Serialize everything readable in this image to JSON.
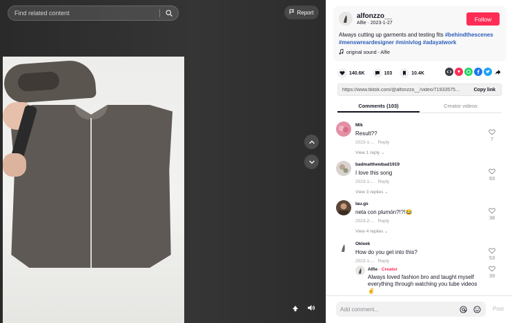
{
  "search": {
    "placeholder": "Find related content",
    "icon": "search-icon"
  },
  "video": {
    "report_label": "Report",
    "nav_up_icon": "chevron-up-icon",
    "nav_down_icon": "chevron-down-icon",
    "miniplayer_icon": "miniplayer-icon",
    "volume_icon": "volume-icon"
  },
  "author": {
    "username": "alfonzzo__",
    "display_name": "Alfie",
    "date": "2023-1-27",
    "follow_label": "Follow"
  },
  "post": {
    "caption_text": "Always cutting up garments and testing fits ",
    "hashtags": [
      "#behindthescenes",
      "#menswreardesigner",
      "#minivlog",
      "#adayatwork"
    ],
    "sound": "original sound - Alfie"
  },
  "stats": {
    "likes": "140.6K",
    "comments": "103",
    "saves": "10.4K"
  },
  "share_icons": [
    "embed-icon",
    "repost-icon",
    "whatsapp-icon",
    "facebook-icon",
    "twitter-icon",
    "share-arrow-icon"
  ],
  "link": {
    "url": "https://www.tiktok.com/@alfonzzo__/video/71933575...",
    "copy_label": "Copy link"
  },
  "tabs": [
    {
      "label": "Comments (103)",
      "active": true
    },
    {
      "label": "Creator videos",
      "active": false
    }
  ],
  "comments": [
    {
      "user": "Mlk",
      "text": "Result??",
      "date": "2023-1-...",
      "reply_label": "Reply",
      "replies_label": "View 1 reply",
      "likes": "7"
    },
    {
      "user": "badmatthewbad1919",
      "text": "I love this song",
      "date": "2023-1-...",
      "reply_label": "Reply",
      "replies_label": "View 3 replies",
      "likes": "93"
    },
    {
      "user": "lau.gs",
      "text": "neta con plumón?!?!😂",
      "date": "2023-2-...",
      "reply_label": "Reply",
      "replies_label": "View 4 replies",
      "likes": "38"
    },
    {
      "user": "Okleek",
      "text": "How do you get into this?",
      "date": "2023-1-...",
      "reply_label": "Reply",
      "likes": "53"
    }
  ],
  "creator_reply": {
    "user": "Alfie",
    "badge": "· Creator",
    "text": "Always loved fashion bro and taught myself everything through watching you tube videos ✌",
    "likes": "39"
  },
  "composer": {
    "placeholder": "Add comment...",
    "post_label": "Post",
    "mention_icon": "at-icon",
    "emoji_icon": "emoji-icon"
  },
  "colors": {
    "accent": "#fe2c55",
    "hashtag": "#2b5db9"
  }
}
